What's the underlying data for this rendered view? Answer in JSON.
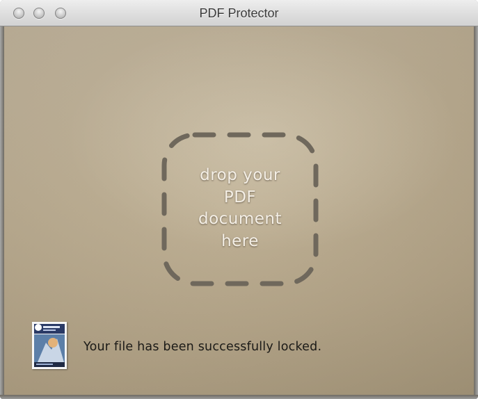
{
  "window": {
    "title": "PDF Protector"
  },
  "dropzone": {
    "text_lines": [
      "drop your",
      "PDF",
      "document",
      "here"
    ]
  },
  "status": {
    "message": "Your file has been successfully locked.",
    "thumbnail": "pdf-document-thumbnail"
  },
  "colors": {
    "background": "#c1b398",
    "dash": "#6f685c",
    "dropzone_text": "#f4efe6",
    "status_text": "#1b1a17"
  }
}
